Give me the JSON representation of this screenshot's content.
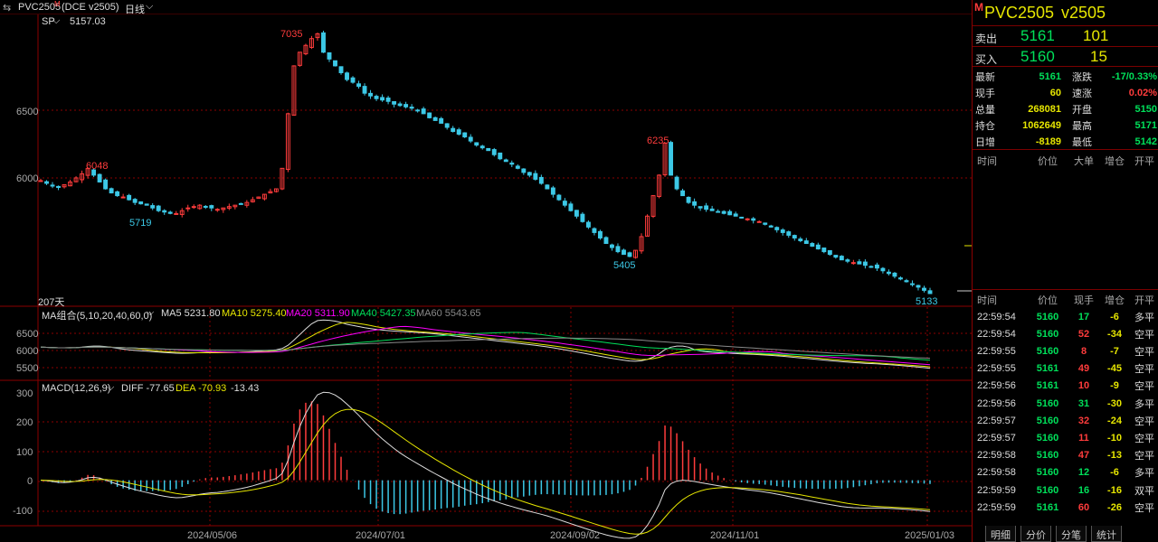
{
  "topbar": {
    "symbol": "PVC2505",
    "m_mark": "M",
    "exchange": "(DCE  v2505)",
    "period": "日线"
  },
  "main": {
    "sp_label": "SP",
    "sp_value": "5157.03",
    "price_ticks": [
      "6500",
      "6000"
    ],
    "annotations": [
      {
        "text": "7035",
        "color": "red"
      },
      {
        "text": "6048",
        "color": "red"
      },
      {
        "text": "5719",
        "color": "cyan"
      },
      {
        "text": "6235",
        "color": "red"
      },
      {
        "text": "5405",
        "color": "cyan"
      },
      {
        "text": "5133",
        "color": "cyan"
      }
    ],
    "days": "207天"
  },
  "ma_panel": {
    "title": "MA组合(5,10,20,40,60,0)",
    "ma5": "MA5 5231.80",
    "ma10": "MA10 5275.40",
    "ma20": "MA20 5311.90",
    "ma40": "MA40 5427.35",
    "ma60": "MA60 5543.65",
    "ticks": [
      "6500",
      "6000",
      "5500"
    ]
  },
  "macd_panel": {
    "title": "MACD(12,26,9)",
    "diff": "DIFF -77.65",
    "dea": "DEA -70.93",
    "macd": "-13.43",
    "ticks": [
      "300",
      "200",
      "100",
      "0",
      "-100"
    ]
  },
  "x_axis": [
    "2024/05/06",
    "2024/07/01",
    "2024/09/02",
    "2024/11/01",
    "2025/01/03"
  ],
  "quote": {
    "symbol": "PVC2505",
    "code": "v2505",
    "sell_label": "卖出",
    "sell_price": "5161",
    "sell_vol": "101",
    "buy_label": "买入",
    "buy_price": "5160",
    "buy_vol": "15",
    "stats": [
      {
        "l1": "最新",
        "v1": "5161",
        "c1": "green",
        "l2": "涨跌",
        "v2": "-17/0.33%",
        "c2": "green"
      },
      {
        "l1": "现手",
        "v1": "60",
        "c1": "yellow",
        "l2": "速涨",
        "v2": "0.02%",
        "c2": "red"
      },
      {
        "l1": "总量",
        "v1": "268081",
        "c1": "yellow",
        "l2": "开盘",
        "v2": "5150",
        "c2": "green"
      },
      {
        "l1": "持仓",
        "v1": "1062649",
        "c1": "yellow",
        "l2": "最高",
        "v2": "5171",
        "c2": "green"
      },
      {
        "l1": "日增",
        "v1": "-8189",
        "c1": "yellow",
        "l2": "最低",
        "v2": "5142",
        "c2": "green"
      }
    ],
    "big_header": [
      "时间",
      "价位",
      "大单",
      "增仓",
      "开平"
    ],
    "tick_header": [
      "时间",
      "价位",
      "现手",
      "增仓",
      "开平"
    ],
    "ticks": [
      {
        "t": "22:59:54",
        "p": "5160",
        "v": "17",
        "vc": "green",
        "z": "-6",
        "k": "多平"
      },
      {
        "t": "22:59:54",
        "p": "5160",
        "v": "52",
        "vc": "red",
        "z": "-34",
        "k": "空平"
      },
      {
        "t": "22:59:55",
        "p": "5160",
        "v": "8",
        "vc": "red",
        "z": "-7",
        "k": "空平"
      },
      {
        "t": "22:59:55",
        "p": "5161",
        "v": "49",
        "vc": "red",
        "z": "-45",
        "k": "空平"
      },
      {
        "t": "22:59:56",
        "p": "5161",
        "v": "10",
        "vc": "red",
        "z": "-9",
        "k": "空平"
      },
      {
        "t": "22:59:56",
        "p": "5160",
        "v": "31",
        "vc": "green",
        "z": "-30",
        "k": "多平"
      },
      {
        "t": "22:59:57",
        "p": "5160",
        "v": "32",
        "vc": "red",
        "z": "-24",
        "k": "空平"
      },
      {
        "t": "22:59:57",
        "p": "5160",
        "v": "11",
        "vc": "red",
        "z": "-10",
        "k": "空平"
      },
      {
        "t": "22:59:58",
        "p": "5160",
        "v": "47",
        "vc": "red",
        "z": "-13",
        "k": "空平"
      },
      {
        "t": "22:59:58",
        "p": "5160",
        "v": "12",
        "vc": "green",
        "z": "-6",
        "k": "多平"
      },
      {
        "t": "22:59:59",
        "p": "5160",
        "v": "16",
        "vc": "green",
        "z": "-16",
        "k": "双平"
      },
      {
        "t": "22:59:59",
        "p": "5161",
        "v": "60",
        "vc": "red",
        "z": "-26",
        "k": "空平"
      }
    ],
    "tabs": [
      "明细",
      "分价",
      "分笔",
      "统计"
    ]
  },
  "chart_data": {
    "type": "candlestick",
    "x_ticks": [
      "2024/05/06",
      "2024/07/01",
      "2024/09/02",
      "2024/11/01",
      "2025/01/03"
    ],
    "close_approx": [
      5960,
      5940,
      5920,
      5910,
      5930,
      5950,
      5980,
      6010,
      6048,
      6000,
      5950,
      5900,
      5870,
      5850,
      5840,
      5820,
      5800,
      5790,
      5780,
      5760,
      5740,
      5730,
      5720,
      5719,
      5740,
      5760,
      5770,
      5780,
      5770,
      5760,
      5750,
      5760,
      5770,
      5780,
      5790,
      5800,
      5820,
      5840,
      5860,
      5880,
      5900,
      6050,
      6450,
      6800,
      6900,
      6950,
      7000,
      7035,
      6900,
      6850,
      6800,
      6750,
      6700,
      6680,
      6650,
      6600,
      6580,
      6560,
      6550,
      6540,
      6520,
      6510,
      6500,
      6490,
      6470,
      6450,
      6420,
      6400,
      6380,
      6350,
      6320,
      6300,
      6280,
      6250,
      6220,
      6200,
      6180,
      6150,
      6120,
      6100,
      6080,
      6050,
      6020,
      6000,
      5970,
      5940,
      5900,
      5860,
      5820,
      5780,
      5740,
      5700,
      5660,
      5620,
      5580,
      5540,
      5500,
      5470,
      5440,
      5420,
      5405,
      5450,
      5550,
      5700,
      5850,
      6000,
      6235,
      6000,
      5900,
      5850,
      5800,
      5780,
      5760,
      5750,
      5740,
      5730,
      5720,
      5710,
      5700,
      5690,
      5680,
      5670,
      5660,
      5640,
      5620,
      5600,
      5580,
      5560,
      5540,
      5520,
      5500,
      5480,
      5460,
      5440,
      5420,
      5400,
      5380,
      5370,
      5360,
      5350,
      5340,
      5330,
      5320,
      5300,
      5280,
      5260,
      5240,
      5220,
      5200,
      5180,
      5157,
      5133
    ],
    "ylim": [
      5100,
      7150
    ],
    "ma": {
      "MA5": 5231.8,
      "MA10": 5275.4,
      "MA20": 5311.9,
      "MA40": 5427.35,
      "MA60": 5543.65
    },
    "macd": {
      "DIFF": -77.65,
      "DEA": -70.93,
      "MACD": -13.43,
      "ylim": [
        -130,
        310
      ]
    },
    "colors": {
      "up": "#ff3c3c",
      "down": "#3cc8e6",
      "ma5": "#dddddd",
      "ma10": "#e6e600",
      "ma20": "#ff00ff",
      "ma40": "#00e05a",
      "ma60": "#888888"
    }
  }
}
